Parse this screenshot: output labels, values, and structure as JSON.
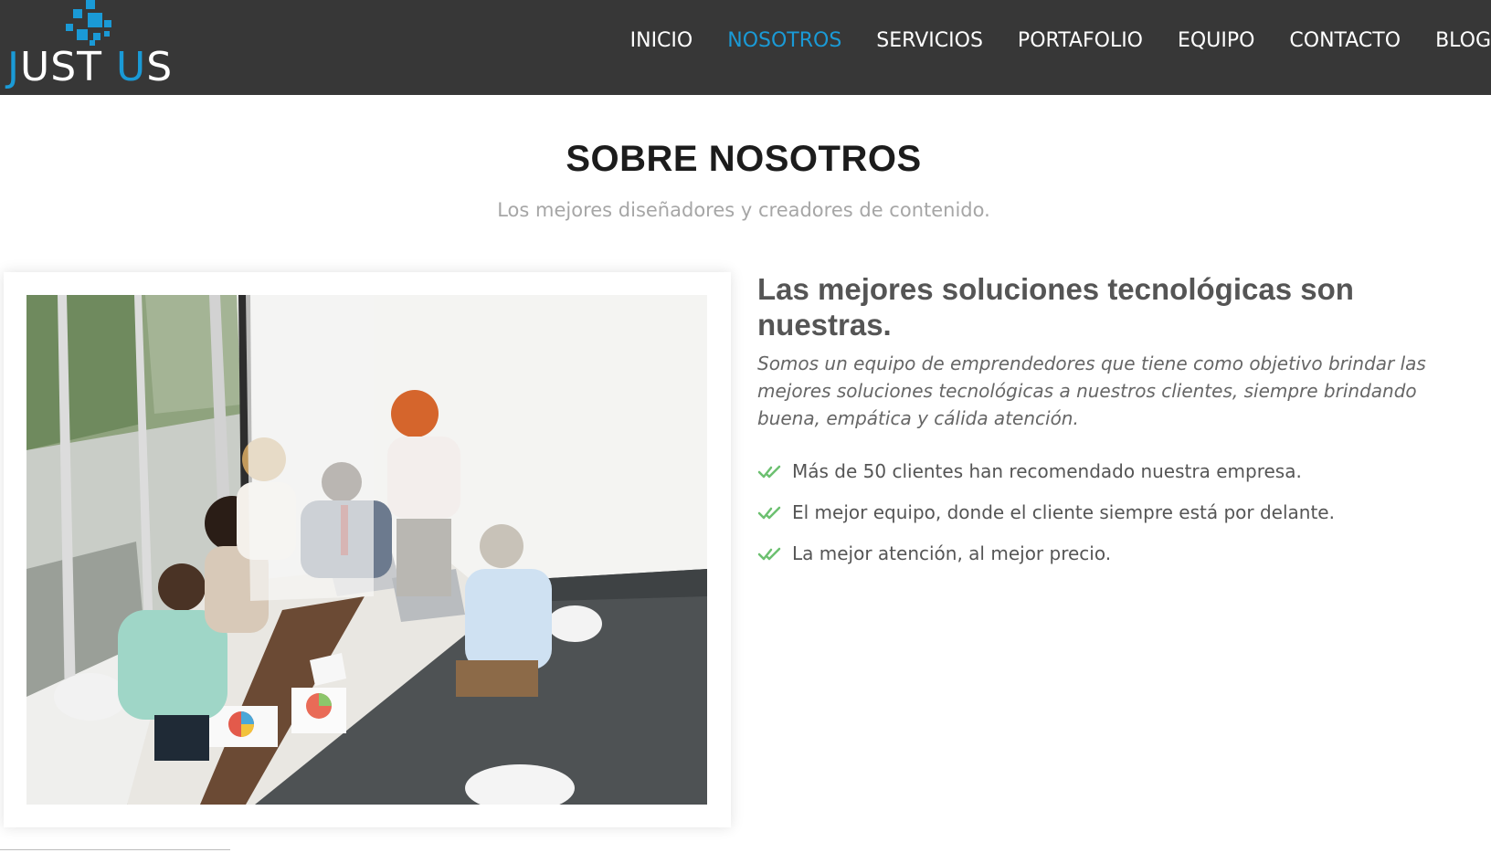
{
  "brand": {
    "logo_text_part1": "J",
    "logo_text_part2": "UST ",
    "logo_text_part3": "U",
    "logo_text_part4": "S",
    "accent_color": "#1a9ad6",
    "nav_bg_color": "#373737"
  },
  "nav": {
    "items": [
      {
        "label": "INICIO",
        "active": false
      },
      {
        "label": "NOSOTROS",
        "active": true
      },
      {
        "label": "SERVICIOS",
        "active": false
      },
      {
        "label": "PORTAFOLIO",
        "active": false
      },
      {
        "label": "EQUIPO",
        "active": false
      },
      {
        "label": "CONTACTO",
        "active": false
      },
      {
        "label": "BLOG",
        "active": false
      }
    ]
  },
  "section": {
    "title": "SOBRE NOSOTROS",
    "subtitle": "Los mejores diseñadores y creadores de contenido."
  },
  "about": {
    "image_icon": "team-meeting-photo",
    "heading": "Las mejores soluciones tecnológicas son nuestras.",
    "lead": "Somos un equipo de emprendedores que tiene como objetivo brindar las mejores soluciones tecnológicas a nuestros clientes, siempre brindando buena, empática y cálida atención.",
    "features": [
      {
        "icon": "double-check-icon",
        "text": "Más de 50 clientes han recomendado nuestra empresa."
      },
      {
        "icon": "double-check-icon",
        "text": "El mejor equipo, donde el cliente siempre está por delante."
      },
      {
        "icon": "double-check-icon",
        "text": "La mejor atención, al mejor precio."
      }
    ],
    "check_color": "#6cc070"
  }
}
